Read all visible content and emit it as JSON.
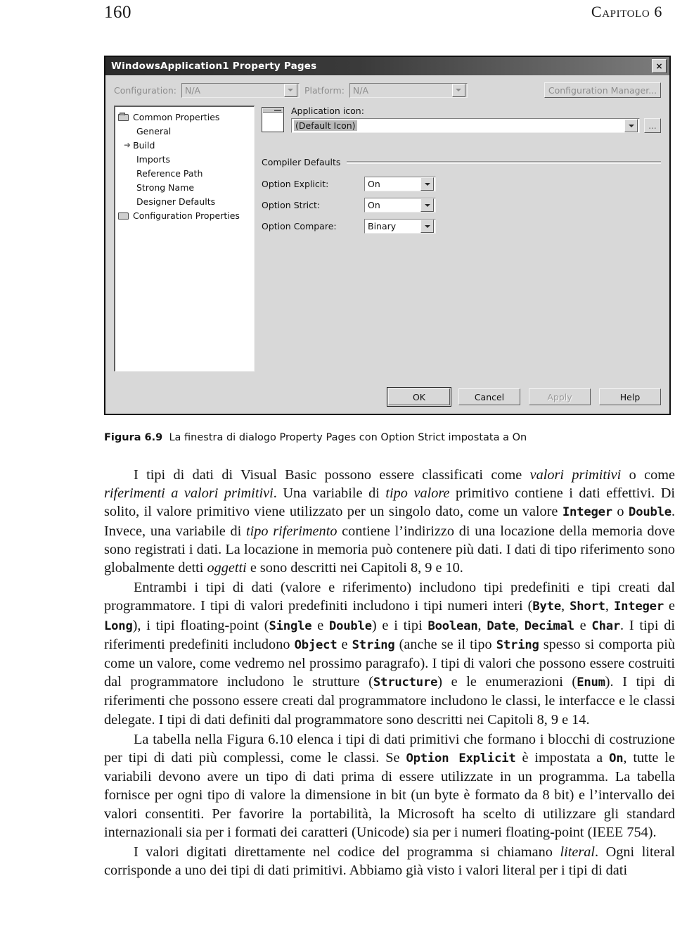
{
  "page": {
    "folio": "160",
    "chapter_head": "Capitolo 6"
  },
  "dialog": {
    "title": "WindowsApplication1 Property Pages",
    "close_icon": "×",
    "configuration": {
      "label": "Configuration:",
      "value": "N/A",
      "platform_label": "Platform:",
      "platform_value": "N/A",
      "manager_button": "Configuration Manager..."
    },
    "tree": [
      {
        "label": "Common Properties",
        "level": 0,
        "icon": "folder-open",
        "marker": ""
      },
      {
        "label": "General",
        "level": 1,
        "icon": "",
        "marker": ""
      },
      {
        "label": "Build",
        "level": 1,
        "icon": "",
        "marker": "➜"
      },
      {
        "label": "Imports",
        "level": 1,
        "icon": "",
        "marker": ""
      },
      {
        "label": "Reference Path",
        "level": 1,
        "icon": "",
        "marker": ""
      },
      {
        "label": "Strong Name",
        "level": 1,
        "icon": "",
        "marker": ""
      },
      {
        "label": "Designer Defaults",
        "level": 1,
        "icon": "",
        "marker": ""
      },
      {
        "label": "Configuration Properties",
        "level": 0,
        "icon": "folder-closed",
        "marker": ""
      }
    ],
    "application_icon": {
      "label": "Application icon:",
      "value": "(Default Icon)",
      "browse_label": "..."
    },
    "compiler_defaults": {
      "group_title": "Compiler Defaults",
      "options": [
        {
          "label": "Option Explicit:",
          "value": "On"
        },
        {
          "label": "Option Strict:",
          "value": "On"
        },
        {
          "label": "Option Compare:",
          "value": "Binary"
        }
      ]
    },
    "footer_buttons": [
      {
        "label": "OK",
        "state": "default"
      },
      {
        "label": "Cancel",
        "state": "normal"
      },
      {
        "label": "Apply",
        "state": "disabled"
      },
      {
        "label": "Help",
        "state": "normal"
      }
    ]
  },
  "caption": {
    "number": "Figura 6.9",
    "text": "La finestra di dialogo Property Pages con Option Strict impostata a On"
  },
  "paragraphs": [
    {
      "id": "p1",
      "parts": [
        {
          "t": "I tipi di dati di Visual Basic possono essere classificati come ",
          "s": "r"
        },
        {
          "t": "valori primitivi",
          "s": "i"
        },
        {
          "t": " o come ",
          "s": "r"
        },
        {
          "t": "riferimenti a valori primitivi",
          "s": "i"
        },
        {
          "t": ". Una variabile di ",
          "s": "r"
        },
        {
          "t": "tipo valore",
          "s": "i"
        },
        {
          "t": " primitivo contiene i dati effettivi. Di solito, il valore primitivo viene utilizzato per un singolo dato, come un valore ",
          "s": "r"
        },
        {
          "t": "Integer",
          "s": "c"
        },
        {
          "t": " o ",
          "s": "r"
        },
        {
          "t": "Double",
          "s": "c"
        },
        {
          "t": ". Invece, una variabile di ",
          "s": "r"
        },
        {
          "t": "tipo riferimento",
          "s": "i"
        },
        {
          "t": " contiene l’indirizzo di una locazione della memoria dove sono registrati i dati. La locazione in memoria può contenere più dati. I dati di tipo riferimento sono globalmente detti ",
          "s": "r"
        },
        {
          "t": "oggetti",
          "s": "i"
        },
        {
          "t": " e sono descritti nei Capitoli 8, 9 e 10.",
          "s": "r"
        }
      ]
    },
    {
      "id": "p2",
      "parts": [
        {
          "t": "Entrambi i tipi di dati (valore e riferimento) includono tipi predefiniti e tipi creati dal programmatore. I tipi di valori predefiniti includono i tipi numeri interi (",
          "s": "r"
        },
        {
          "t": "Byte",
          "s": "c"
        },
        {
          "t": ", ",
          "s": "r"
        },
        {
          "t": "Short",
          "s": "c"
        },
        {
          "t": ", ",
          "s": "r"
        },
        {
          "t": "Integer",
          "s": "c"
        },
        {
          "t": " e ",
          "s": "r"
        },
        {
          "t": "Long",
          "s": "c"
        },
        {
          "t": "), i tipi floating-point (",
          "s": "r"
        },
        {
          "t": "Single",
          "s": "c"
        },
        {
          "t": " e ",
          "s": "r"
        },
        {
          "t": "Double",
          "s": "c"
        },
        {
          "t": ") e i tipi ",
          "s": "r"
        },
        {
          "t": "Boolean",
          "s": "c"
        },
        {
          "t": ", ",
          "s": "r"
        },
        {
          "t": "Date",
          "s": "c"
        },
        {
          "t": ", ",
          "s": "r"
        },
        {
          "t": "Decimal",
          "s": "c"
        },
        {
          "t": " e ",
          "s": "r"
        },
        {
          "t": "Char",
          "s": "c"
        },
        {
          "t": ". I tipi di riferimenti predefiniti includono ",
          "s": "r"
        },
        {
          "t": "Object",
          "s": "c"
        },
        {
          "t": " e ",
          "s": "r"
        },
        {
          "t": "String",
          "s": "c"
        },
        {
          "t": " (anche se il tipo ",
          "s": "r"
        },
        {
          "t": "String",
          "s": "c"
        },
        {
          "t": " spesso si comporta più come un valore, come vedremo nel prossimo paragrafo). I tipi di valori che possono essere costruiti dal programmatore includono le strutture (",
          "s": "r"
        },
        {
          "t": "Structure",
          "s": "c"
        },
        {
          "t": ") e le enumerazioni (",
          "s": "r"
        },
        {
          "t": "Enum",
          "s": "c"
        },
        {
          "t": "). I tipi di riferimenti che possono essere creati dal programmatore includono le classi, le interfacce e le classi delegate. I tipi di dati definiti dal programmatore sono descritti nei Capitoli 8, 9 e 14.",
          "s": "r"
        }
      ]
    },
    {
      "id": "p3",
      "parts": [
        {
          "t": "La tabella nella Figura 6.10 elenca i tipi di dati primitivi che formano i blocchi di costruzione per tipi di dati più complessi, come le classi. Se ",
          "s": "r"
        },
        {
          "t": "Option Explicit",
          "s": "c"
        },
        {
          "t": " è impostata a ",
          "s": "r"
        },
        {
          "t": "On",
          "s": "c"
        },
        {
          "t": ", tutte le variabili devono avere un tipo di dati prima di essere utilizzate in un programma. La tabella fornisce per ogni tipo di valore la dimensione in bit (un byte è formato da 8 bit) e l’intervallo dei valori consentiti. Per favorire la portabilità, la Microsoft ha scelto di utilizzare gli standard internazionali sia per i formati dei caratteri (Unicode) sia per i numeri floating-point (IEEE 754).",
          "s": "r"
        }
      ]
    },
    {
      "id": "p4",
      "parts": [
        {
          "t": "I valori digitati direttamente nel codice del programma si chiamano ",
          "s": "r"
        },
        {
          "t": "literal",
          "s": "i"
        },
        {
          "t": ". Ogni literal corrisponde a uno dei tipi di dati primitivi. Abbiamo già visto i valori literal per i tipi di dati",
          "s": "r"
        }
      ]
    }
  ]
}
